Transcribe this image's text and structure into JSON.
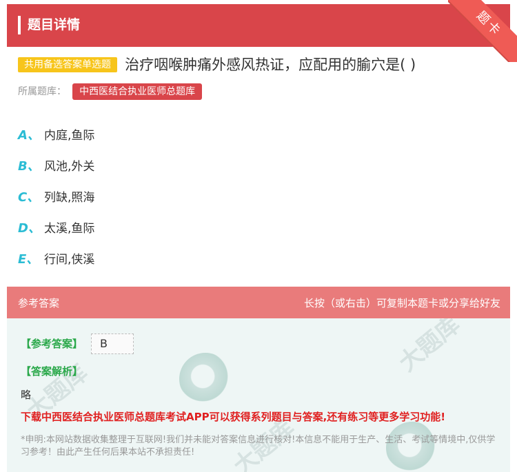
{
  "header": {
    "title": "题目详情"
  },
  "corner_badge": {
    "label": "题卡"
  },
  "question": {
    "type_tag": "共用备选答案单选题",
    "text": "治疗咽喉肿痛外感风热证，应配用的腧穴是( )"
  },
  "library": {
    "label": "所属题库：",
    "name": "中西医结合执业医师总题库"
  },
  "options": [
    {
      "letter": "A、",
      "text": "内庭,鱼际"
    },
    {
      "letter": "B、",
      "text": "风池,外关"
    },
    {
      "letter": "C、",
      "text": "列缺,照海"
    },
    {
      "letter": "D、",
      "text": "太溪,鱼际"
    },
    {
      "letter": "E、",
      "text": "行间,侠溪"
    }
  ],
  "answer_section": {
    "title": "参考答案",
    "hint": "长按（或右击）可复制本题卡或分享给好友",
    "answer_label": "【参考答案】",
    "answer_value": "B",
    "analysis_label": "【答案解析】",
    "analysis_text": "略",
    "download_text": "下载中西医结合执业医师总题库考试APP可以获得系列题目与答案,还有练习等更多学习功能!",
    "disclaimer": "*申明:本网站数据收集整理于互联网!我们并未能对答案信息进行核对!本信息不能用于生产、生活、考试等情境中,仅供学习参考！由此产生任何后果本站不承担责任!"
  },
  "colors": {
    "header_bg": "#d9454a",
    "type_tag_bg": "#f7c51b",
    "option_letter": "#2bbcd4",
    "answer_header_bg": "#e97b7b",
    "answer_label": "#2aa84a",
    "download_text": "#e02020"
  }
}
